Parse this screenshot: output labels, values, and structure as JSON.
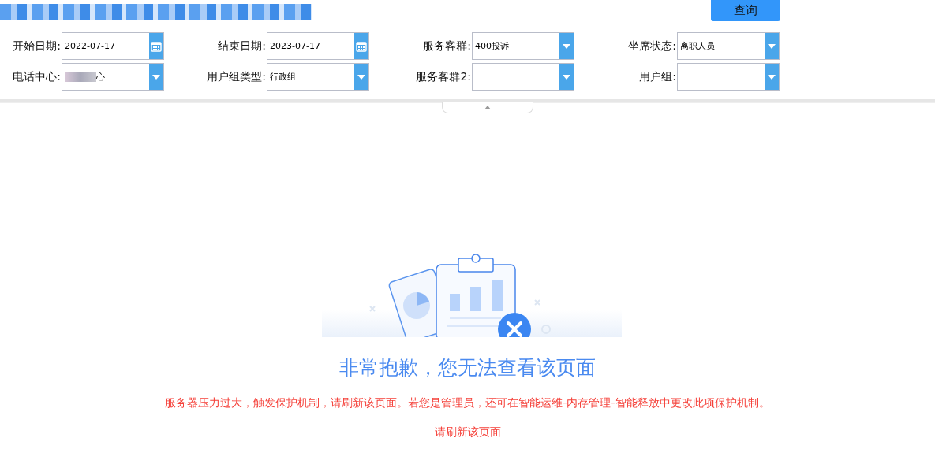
{
  "query_button": "查询",
  "filters": [
    {
      "kind": "date",
      "label": "开始日期:",
      "value": "2022-07-17"
    },
    {
      "kind": "date",
      "label": "结束日期:",
      "value": "2023-07-17"
    },
    {
      "kind": "select",
      "label": "服务客群:",
      "value": "400投诉"
    },
    {
      "kind": "select",
      "label": "坐席状态:",
      "value": "离职人员"
    },
    {
      "kind": "select",
      "label": "电话中心:",
      "value": "心",
      "redacted": true
    },
    {
      "kind": "select",
      "label": "用户组类型:",
      "value": "行政组"
    },
    {
      "kind": "select",
      "label": "服务客群2:"
    },
    {
      "kind": "select",
      "label": "用户组:"
    }
  ],
  "error": {
    "title": "非常抱歉，您无法查看该页面",
    "message": "服务器压力过大，触发保护机制，请刷新该页面。若您是管理员，还可在智能运维-内存管理-智能释放中更改此项保护机制。",
    "link": "请刷新该页面"
  }
}
